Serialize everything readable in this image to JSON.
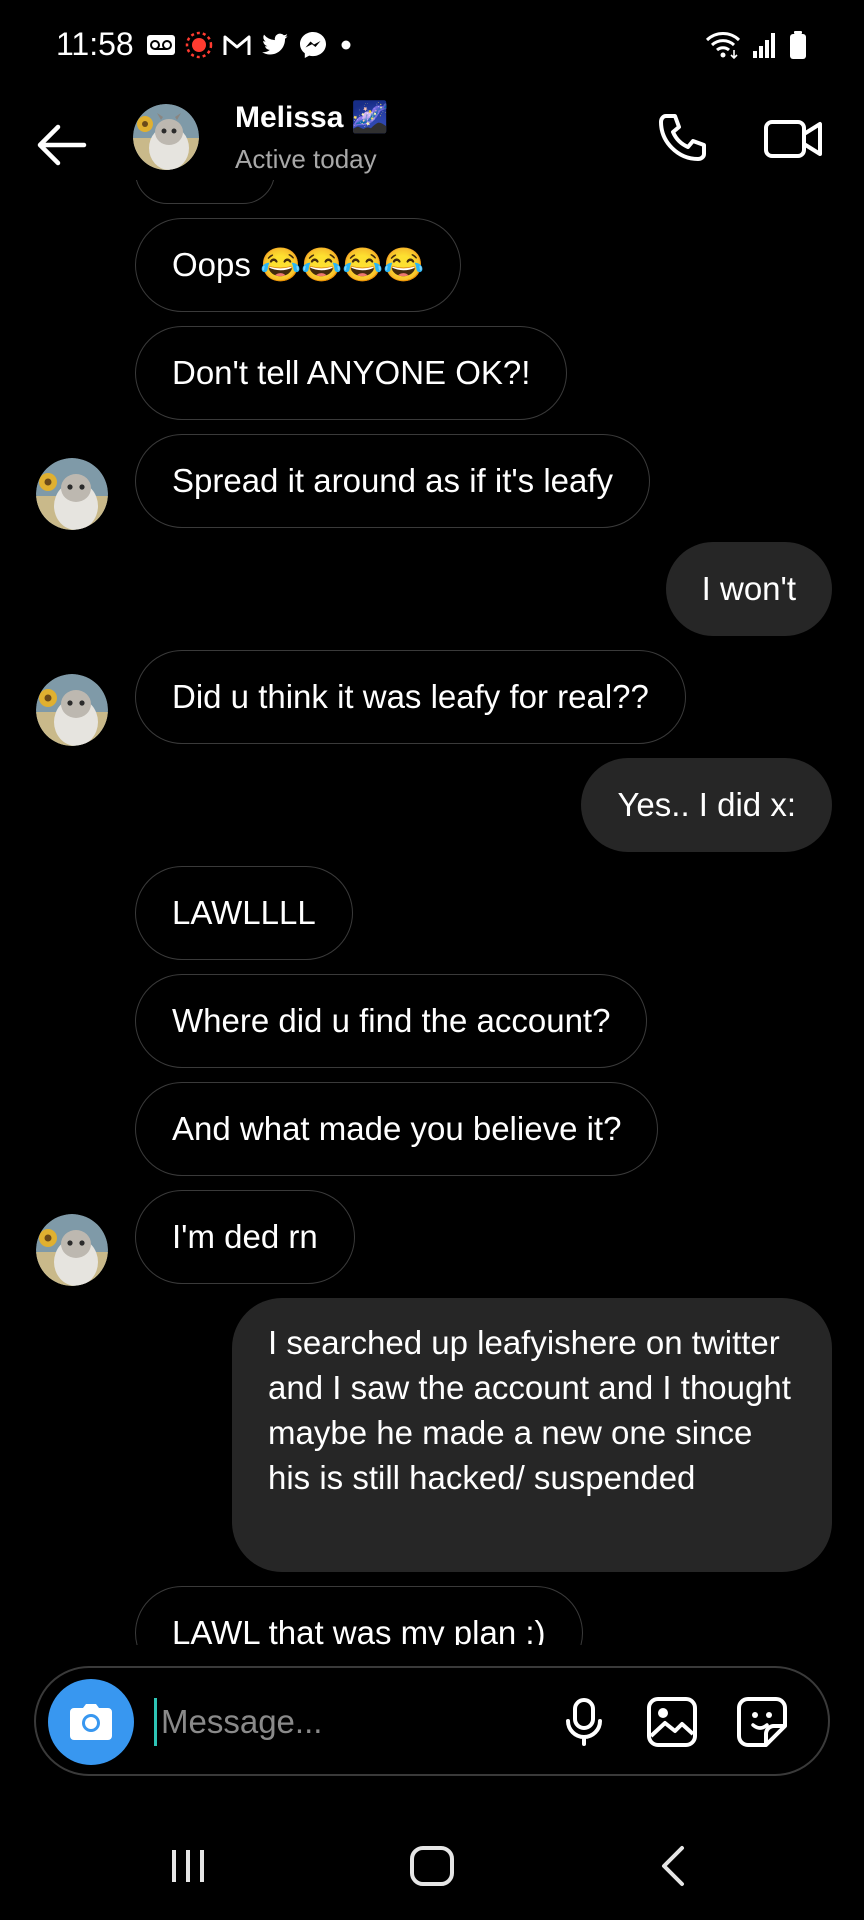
{
  "status_bar": {
    "time": "11:58",
    "notification_icons": [
      "voicemail-icon",
      "screen-recorder-icon",
      "gmail-icon",
      "twitter-icon",
      "messenger-icon",
      "dot-icon"
    ],
    "system_icons": [
      "wifi-icon",
      "signal-icon",
      "battery-icon"
    ]
  },
  "header": {
    "name": "Melissa",
    "name_emoji": "🌌",
    "status": "Active today"
  },
  "messages": [
    {
      "from": "them",
      "text": "Oops 😂😂😂😂"
    },
    {
      "from": "them",
      "text": "Don't tell ANYONE OK?!"
    },
    {
      "from": "them",
      "text": "Spread it around as if it's leafy"
    },
    {
      "from": "me",
      "text": "I won't"
    },
    {
      "from": "them",
      "text": "Did u think it was leafy for real??"
    },
    {
      "from": "me",
      "text": "Yes.. I did x:"
    },
    {
      "from": "them",
      "text": "LAWLLLL"
    },
    {
      "from": "them",
      "text": "Where did u find the account?"
    },
    {
      "from": "them",
      "text": "And what made you believe it?"
    },
    {
      "from": "them",
      "text": "I'm ded rn"
    },
    {
      "from": "me",
      "text": "I searched up leafyishere on twitter and I saw the account and I thought maybe he made a new one since his is still hacked/ suspended"
    },
    {
      "from": "them",
      "text": "LAWL that was my plan :)"
    }
  ],
  "composer": {
    "placeholder": "Message...",
    "value": ""
  },
  "colors": {
    "background": "#000000",
    "sent_bubble": "#262626",
    "received_border": "#3a3a3a",
    "camera_button": "#3897f0",
    "secondary_text": "#a8a8a8"
  }
}
